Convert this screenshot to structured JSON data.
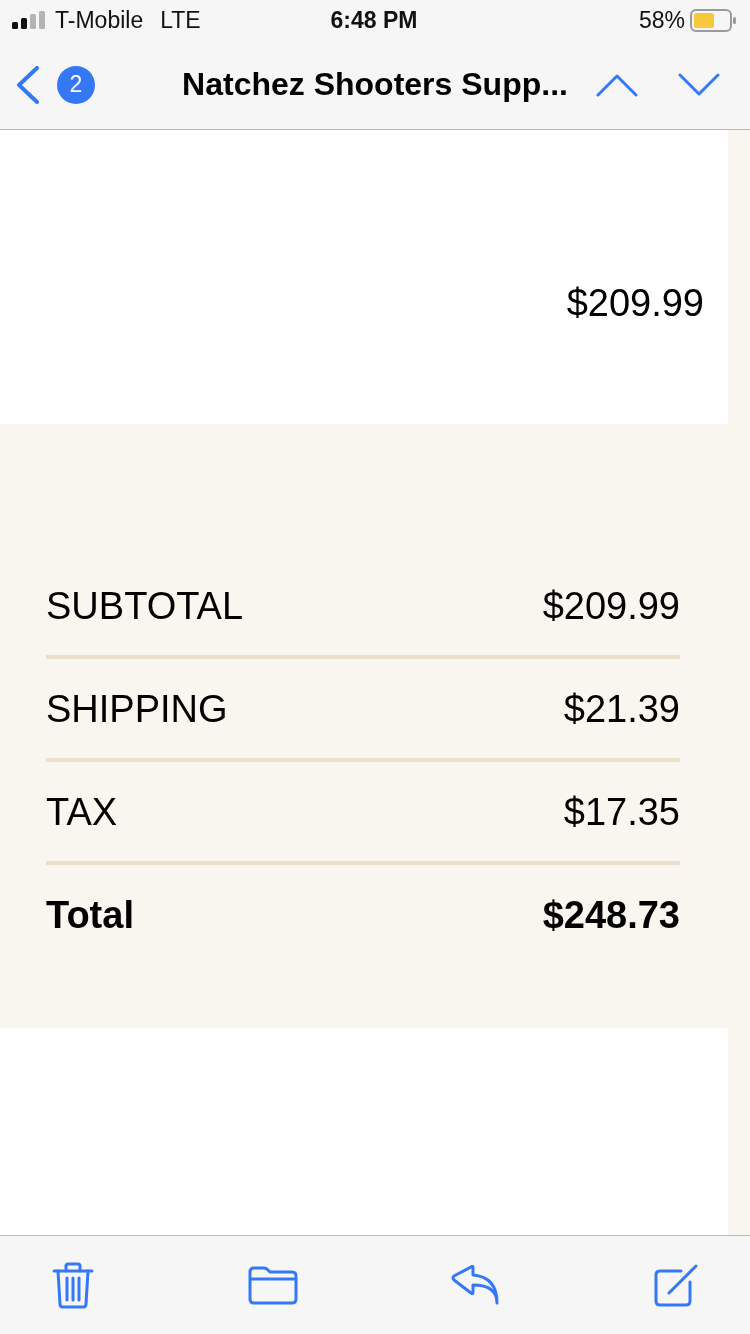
{
  "status_bar": {
    "carrier": "T-Mobile",
    "network": "LTE",
    "time": "6:48 PM",
    "battery": "58%"
  },
  "nav_bar": {
    "unread_count": "2",
    "title": "Natchez Shooters Supp..."
  },
  "item": {
    "price": "$209.99"
  },
  "summary": {
    "rows": [
      {
        "kind": "line",
        "label": "SUBTOTAL",
        "value": "$209.99"
      },
      {
        "kind": "line",
        "label": "SHIPPING",
        "value": "$21.39"
      },
      {
        "kind": "line",
        "label": "TAX",
        "value": "$17.35"
      },
      {
        "kind": "total",
        "label": "Total",
        "value": "$248.73"
      }
    ]
  }
}
